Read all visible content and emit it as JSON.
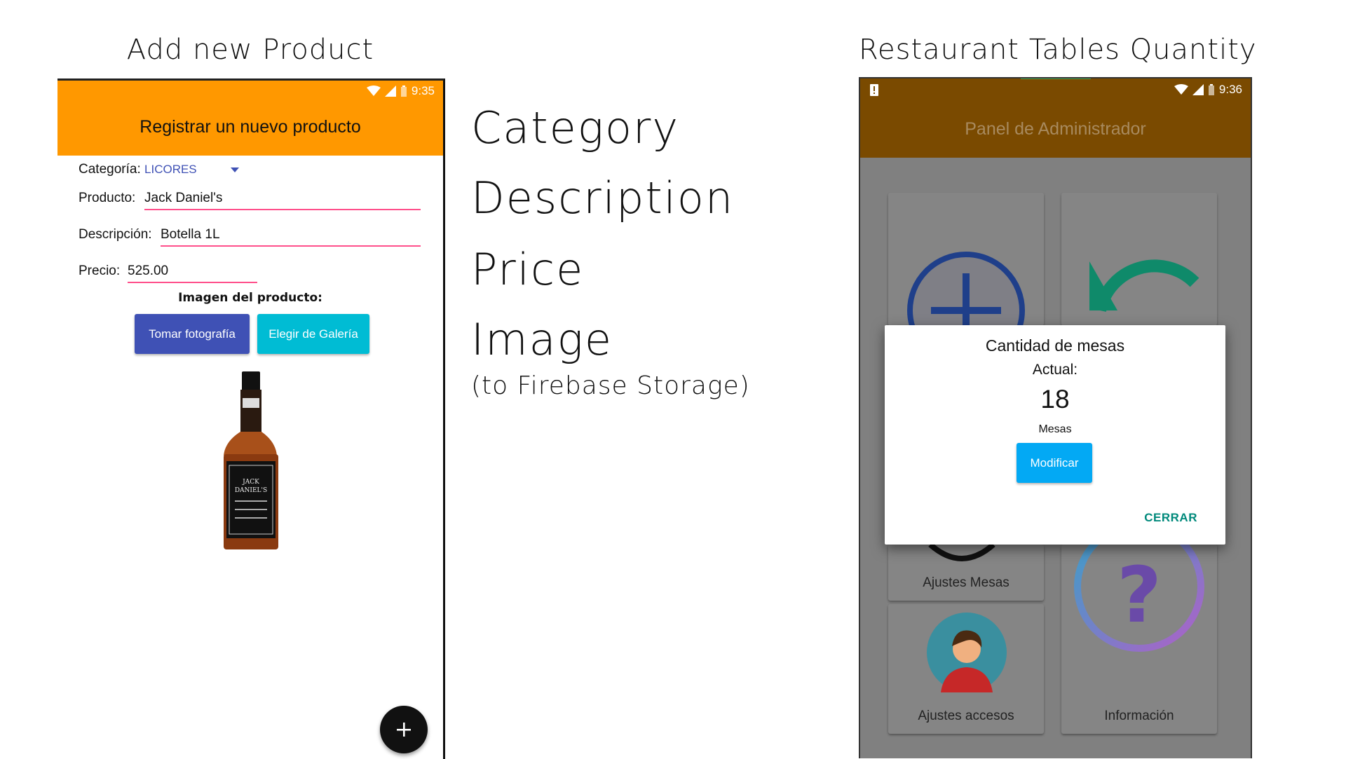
{
  "captions": {
    "left": "Add new Product",
    "right": "Restaurant Tables Quantity"
  },
  "left_phone": {
    "status": {
      "time": "9:35"
    },
    "appbar_title": "Registrar un nuevo producto",
    "category": {
      "label": "Categoría:",
      "value": "LICORES"
    },
    "product": {
      "label": "Producto:",
      "value": "Jack Daniel's"
    },
    "description": {
      "label": "Descripción:",
      "value": "Botella 1L"
    },
    "price": {
      "label": "Precio:",
      "value": "525.00"
    },
    "image_label": "Imagen del producto:",
    "buttons": {
      "take_photo": "Tomar fotografía",
      "gallery": "Elegir de Galería"
    },
    "fab_icon": "plus-icon",
    "colors": {
      "appbar": "#ff9800",
      "btn_photo": "#3f51b5",
      "btn_gallery": "#00bcd4"
    }
  },
  "middle_labels": {
    "category": "Category",
    "description": "Description",
    "price": "Price",
    "image": "Image",
    "image_note": "(to Firebase Storage)"
  },
  "right_phone": {
    "status": {
      "time": "9:36"
    },
    "appbar_title": "Panel de Administrador",
    "tiles": {
      "ajustes_mesas": "Ajustes Mesas",
      "ajustes_accesos": "Ajustes accesos",
      "informacion": "Información"
    },
    "dialog": {
      "title": "Cantidad de mesas",
      "current_label": "Actual:",
      "count": "18",
      "unit": "Mesas",
      "modify_button": "Modificar",
      "close_button": "CERRAR"
    },
    "colors": {
      "appbar": "#7a4a00",
      "modify": "#03a9f4",
      "close": "#00897b"
    }
  }
}
